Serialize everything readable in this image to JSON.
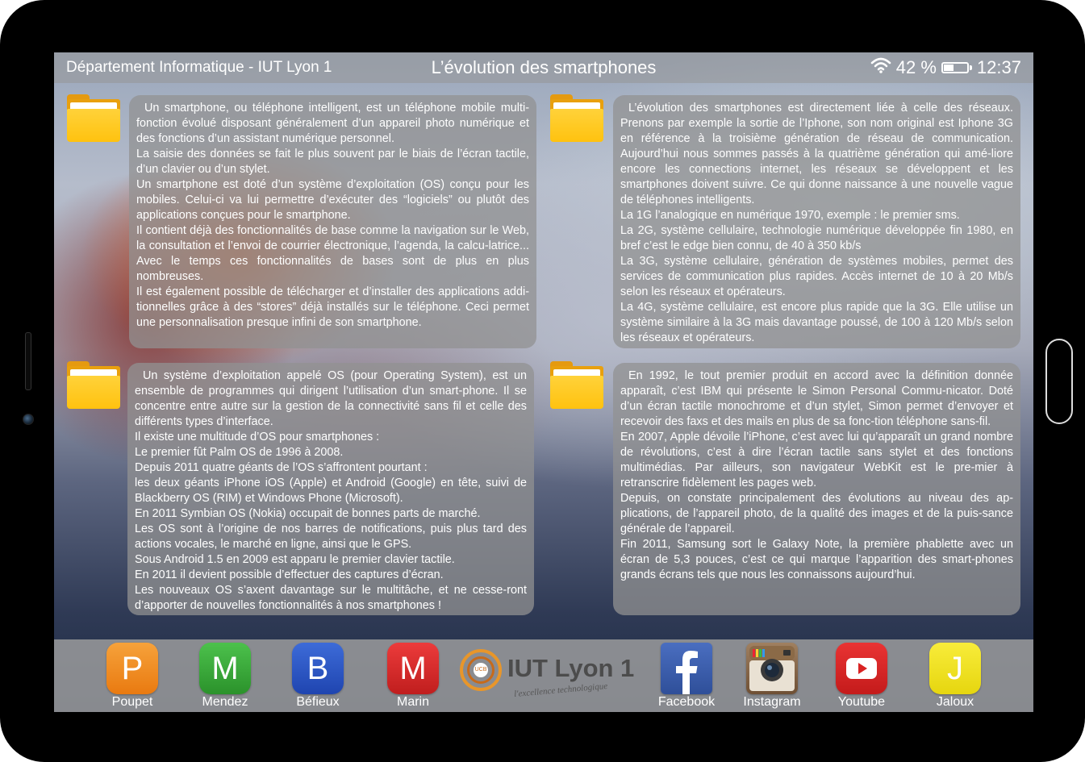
{
  "status_bar": {
    "left_text": "Département Informatique - IUT Lyon 1",
    "title": "L’évolution des smartphones",
    "battery": "42 %",
    "battery_level": 0.42,
    "time": "12:37",
    "icons": [
      "wifi-icon",
      "battery-icon"
    ]
  },
  "panels": [
    {
      "paragraphs": [
        "Un smartphone, ou téléphone intelligent, est un téléphone mobile multi-fonction évolué disposant généralement d’un appareil photo numérique et des fonctions d’un assistant numérique personnel.",
        "La saisie des données se fait le plus souvent par le biais de l’écran tactile, d’un clavier ou d’un stylet.",
        "Un smartphone est doté d’un système d’exploitation (OS) conçu pour les mobiles. Celui-ci va lui permettre d’exécuter des “logiciels” ou plutôt des applications conçues pour le smartphone.",
        "Il contient déjà des fonctionnalités de base comme la navigation sur le Web, la consultation et l’envoi de courrier électronique, l’agenda, la calcu-latrice... Avec le temps ces fonctionnalités de bases sont de plus en plus nombreuses.",
        "Il est également possible de télécharger et d’installer des applications addi-tionnelles grâce à des “stores” déjà installés sur le téléphone. Ceci permet une personnalisation presque infini de son smartphone."
      ]
    },
    {
      "paragraphs": [
        "L’évolution des smartphones est directement liée à celle des réseaux. Prenons par exemple la sortie de l’Iphone, son nom original est Iphone 3G en référence à la troisième génération de réseau de communication. Aujourd’hui nous sommes passés à la quatrième génération qui amé-liore encore les connections internet, les réseaux se développent et les smartphones doivent suivre. Ce qui donne naissance à une nouvelle vague de téléphones intelligents.",
        "La 1G l’analogique en numérique  1970, exemple : le premier sms.",
        "La 2G, système cellulaire, technologie numérique développée fin 1980, en bref c’est le edge bien connu, de 40 à 350 kb/s",
        "La 3G, système cellulaire, génération de systèmes mobiles, permet des services de communication plus rapides. Accès internet de 10 à 20 Mb/s selon les réseaux et opérateurs.",
        "La 4G, système cellulaire, est encore plus rapide que la 3G. Elle utilise un système similaire à la 3G mais davantage poussé, de 100 à 120 Mb/s selon les réseaux et opérateurs."
      ]
    },
    {
      "paragraphs": [
        "Un système d’exploitation  appelé OS (pour Operating System), est un ensemble de programmes qui dirigent l’utilisation d’un smart-phone. Il se concentre entre autre sur la gestion de la connectivité sans fil et celle des différents types d’interface.",
        "Il existe une multitude d’OS pour smartphones :",
        "Le premier fût Palm OS de 1996 à 2008.",
        "Depuis 2011 quatre géants de l’OS s’affrontent pourtant :",
        "les deux géants iPhone iOS (Apple) et Android (Google) en tête, suivi de Blackberry OS (RIM) et Windows Phone (Microsoft).",
        "En 2011 Symbian OS (Nokia) occupait de bonnes parts de marché.",
        "Les OS sont à l’origine de nos barres de notifications, puis plus tard des actions vocales, le marché en ligne, ainsi que le GPS.",
        "Sous Android 1.5 en 2009 est apparu le premier clavier tactile.",
        "En 2011 il devient possible d’effectuer des captures d’écran.",
        "Les nouveaux OS s’axent davantage sur le multitâche, et ne cesse-ront d’apporter de nouvelles fonctionnalités à nos smartphones !"
      ]
    },
    {
      "paragraphs": [
        "En 1992, le tout premier produit en accord avec la définition donnée apparaît, c’est IBM qui présente le Simon Personal Commu-nicator. Doté d’un écran tactile monochrome et d’un stylet, Simon permet d’envoyer et recevoir des faxs et des mails en plus de sa fonc-tion téléphone sans-fil.",
        "En 2007, Apple dévoile l’iPhone, c’est avec lui qu’apparaît un grand nombre de révolutions, c’est à dire l’écran tactile sans stylet et des fonctions multimédias. Par ailleurs, son navigateur WebKit est le pre-mier à retranscrire fidèlement les pages web.",
        "Depuis, on constate principalement des évolutions au niveau des ap-plications, de l’appareil photo, de la qualité des images et de la puis-sance générale de l’appareil.",
        "Fin 2011, Samsung sort le Galaxy Note, la première phablette avec un écran de 5,3 pouces, c’est ce qui marque l’apparition des smart-phones grands écrans tels que nous les connaissons aujourd’hui."
      ]
    }
  ],
  "dock": {
    "apps": [
      {
        "letter": "P",
        "label": "Poupet",
        "color": "#f08a1c"
      },
      {
        "letter": "M",
        "label": "Mendez",
        "color": "#3aa93a"
      },
      {
        "letter": "B",
        "label": "Béfieux",
        "color": "#2a56c8"
      },
      {
        "letter": "M",
        "label": "Marin",
        "color": "#dc2828"
      },
      {
        "label": "Facebook",
        "icon": "facebook-icon",
        "color": "#3b5bab"
      },
      {
        "label": "Instagram",
        "icon": "instagram-icon",
        "color": "#8a6a4a"
      },
      {
        "label": "Youtube",
        "icon": "youtube-icon",
        "color": "#d92323"
      },
      {
        "letter": "J",
        "label": "Jaloux",
        "color": "#f1e21a"
      }
    ],
    "logo": {
      "text": "IUT Lyon 1",
      "tagline": "l'excellence technologique",
      "emblem": "UCB"
    }
  }
}
